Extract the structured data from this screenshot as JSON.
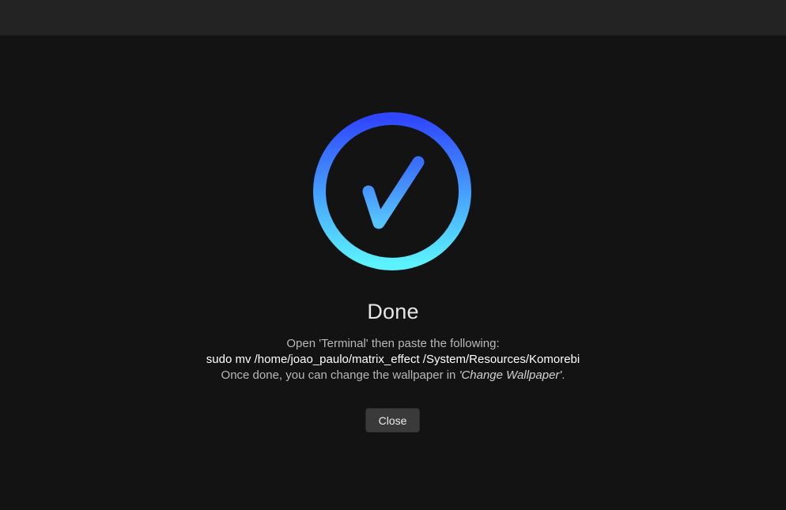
{
  "dialog": {
    "title": "Done",
    "instruction_line": "Open 'Terminal' then paste the following:",
    "command": "sudo mv /home/joao_paulo/matrix_effect /System/Resources/Komorebi",
    "followup_prefix": "Once done, you can change the wallpaper in ",
    "followup_emphasis": "'Change Wallpaper'",
    "followup_suffix": ".",
    "close_label": "Close"
  },
  "icon": {
    "name": "checkmark-circle-icon",
    "gradient_top": "#2f47ff",
    "gradient_bottom": "#5cf3ff"
  },
  "colors": {
    "background": "#131313",
    "titlebar": "#232323",
    "button": "#3a3a3a"
  }
}
